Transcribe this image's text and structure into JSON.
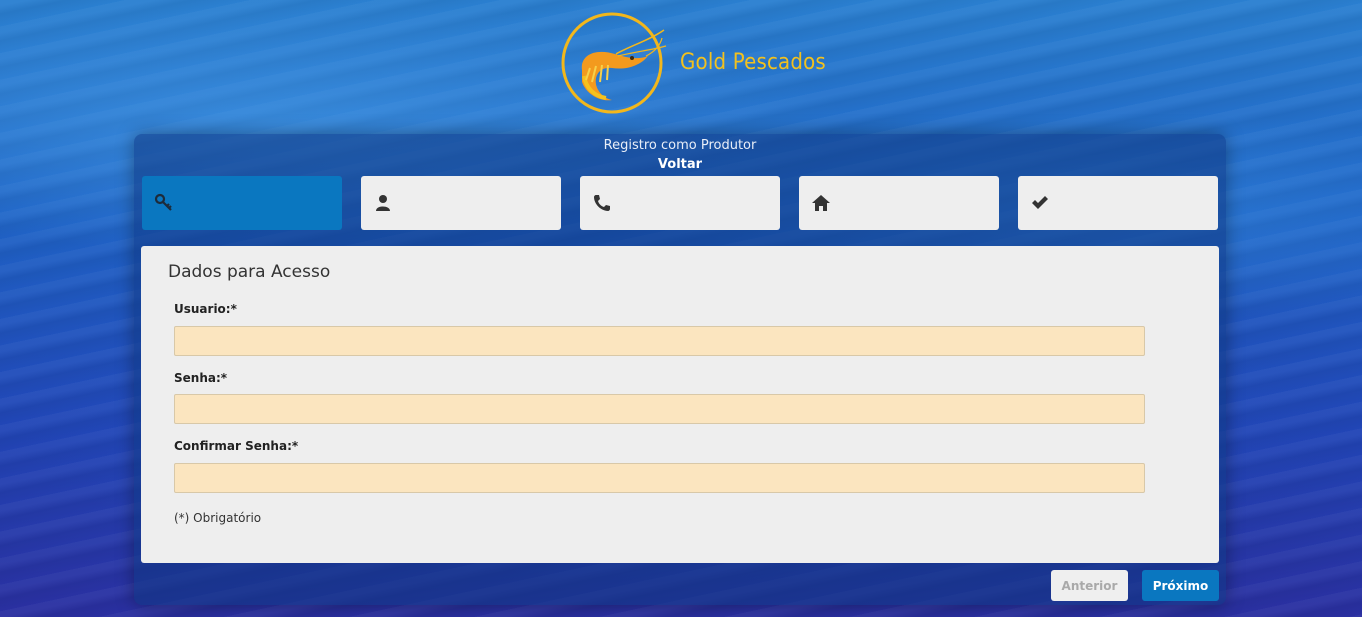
{
  "brand": {
    "name": "Gold Pescados",
    "colors": {
      "gold": "#f2c11e",
      "shrimp": "#f39a1e"
    }
  },
  "panel": {
    "title": "Registro como Produtor",
    "back_link": "Voltar"
  },
  "steps": [
    {
      "icon": "key-icon",
      "active": true
    },
    {
      "icon": "user-icon",
      "active": false
    },
    {
      "icon": "phone-icon",
      "active": false
    },
    {
      "icon": "home-icon",
      "active": false
    },
    {
      "icon": "check-icon",
      "active": false
    }
  ],
  "form": {
    "title": "Dados para Acesso",
    "fields": {
      "usuario": {
        "label": "Usuario:*",
        "value": "",
        "placeholder": ""
      },
      "senha": {
        "label": "Senha:*",
        "value": "",
        "placeholder": ""
      },
      "confirmar_senha": {
        "label": "Confirmar Senha:*",
        "value": "",
        "placeholder": ""
      }
    },
    "required_note": "(*) Obrigatório"
  },
  "buttons": {
    "prev_label": "Anterior",
    "next_label": "Próximo"
  },
  "colors": {
    "accent": "#0a77c0",
    "input_bg": "#fbe5bf",
    "card_bg": "#eeeeee"
  }
}
